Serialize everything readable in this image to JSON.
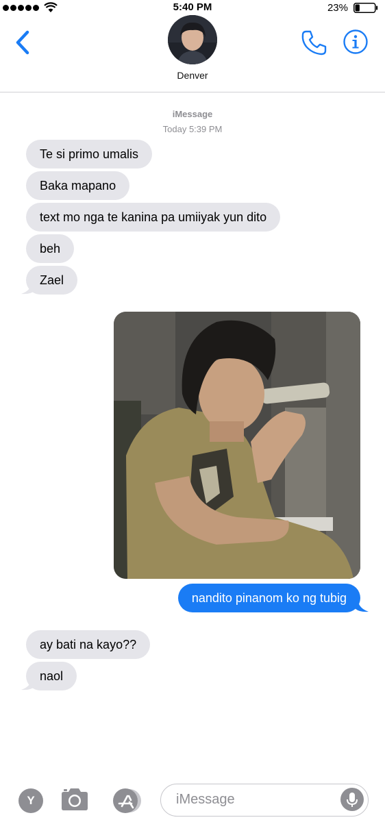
{
  "status_bar": {
    "time": "5:40 PM",
    "battery_percent": "23%",
    "battery_level": 0.23,
    "signal_dots": 5
  },
  "header": {
    "contact_name": "Denver",
    "accent_color": "#1a7cf5",
    "icons": [
      "chevron-left-icon",
      "phone-icon",
      "info-icon"
    ]
  },
  "conversation": {
    "service": "iMessage",
    "timestamp": "Today 5:39 PM",
    "incoming_1": [
      "Te si primo umalis",
      "Baka mapano",
      "text mo nga te kanina pa umiiyak yun dito",
      "beh",
      "Zael"
    ],
    "outgoing": "nandito pinanom ko ng tubig",
    "incoming_2": [
      "ay bati na kayo??",
      "naol"
    ]
  },
  "colors": {
    "incoming_bubble": "#e5e5ea",
    "outgoing_bubble": "#1a7cf5"
  },
  "composer": {
    "yahoo_label": "Y",
    "placeholder": "iMessage",
    "icons": [
      "camera-icon",
      "app-store-icon",
      "microphone-icon"
    ]
  }
}
